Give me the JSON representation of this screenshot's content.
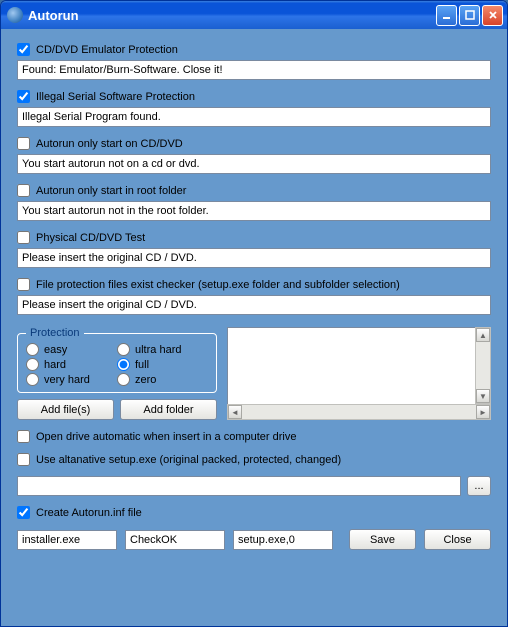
{
  "window": {
    "title": "Autorun"
  },
  "options": {
    "emu_protect": {
      "label": "CD/DVD Emulator Protection",
      "checked": true,
      "msg": "Found: Emulator/Burn-Software. Close it!"
    },
    "illegal_serial": {
      "label": "Illegal Serial Software Protection",
      "checked": true,
      "msg": "Illegal Serial Program found."
    },
    "only_cddvd": {
      "label": "Autorun only start on CD/DVD",
      "checked": false,
      "msg": "You start autorun not on a cd or dvd."
    },
    "only_root": {
      "label": "Autorun only start in root folder",
      "checked": false,
      "msg": "You start autorun not in the root folder."
    },
    "physical_test": {
      "label": "Physical CD/DVD Test",
      "checked": false,
      "msg": "Please insert the original CD / DVD."
    },
    "file_protect": {
      "label": "File protection files exist checker (setup.exe folder and subfolder selection)",
      "checked": false,
      "msg": "Please insert the original CD / DVD."
    }
  },
  "protection": {
    "legend": "Protection",
    "options": [
      {
        "label": "easy",
        "checked": false
      },
      {
        "label": "ultra hard",
        "checked": false
      },
      {
        "label": "hard",
        "checked": false
      },
      {
        "label": "full",
        "checked": true
      },
      {
        "label": "very hard",
        "checked": false
      },
      {
        "label": "zero",
        "checked": false
      }
    ]
  },
  "buttons": {
    "add_files": "Add file(s)",
    "add_folder": "Add folder",
    "save": "Save",
    "close": "Close",
    "browse": "..."
  },
  "lower_checks": {
    "open_drive": {
      "label": "Open drive automatic when insert in a computer drive",
      "checked": false
    },
    "alt_setup": {
      "label": "Use altanative setup.exe (original packed, protected, changed)",
      "checked": false
    }
  },
  "alt_setup_path": "",
  "create_inf": {
    "label": "Create Autorun.inf file",
    "checked": true
  },
  "inf_fields": {
    "installer": "installer.exe",
    "checkok": "CheckOK",
    "setup_icon": "setup.exe,0"
  }
}
